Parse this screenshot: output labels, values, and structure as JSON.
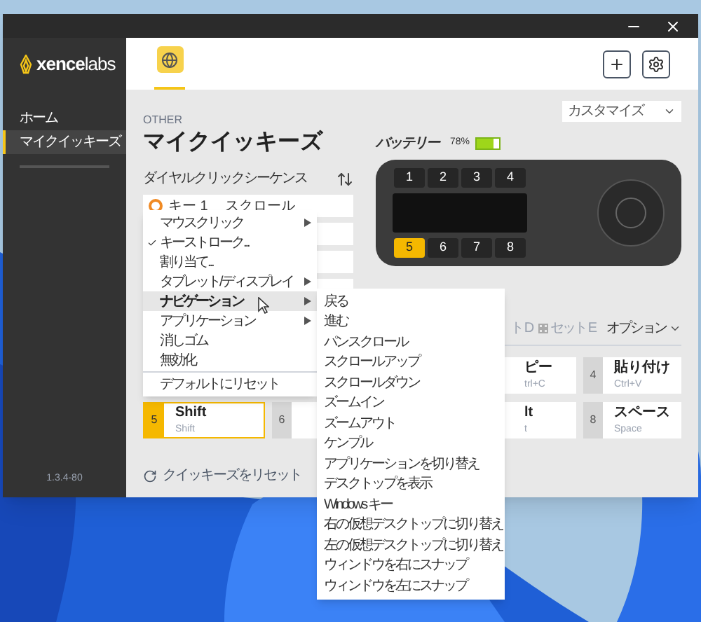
{
  "sidebar": {
    "logo": "**xence**labs",
    "items": [
      {
        "label": "ホーム",
        "selected": false
      },
      {
        "label": "マイクイッキーズ",
        "selected": true
      }
    ],
    "version": "1.3.4-80"
  },
  "app_tabs": [
    {
      "selected": true
    }
  ],
  "header": {
    "section": "OTHER",
    "title": "マイクイッキーズ"
  },
  "dial": {
    "label": "ダイヤルクリックシーケンス",
    "rows": [
      {
        "key": "キー 1",
        "action": "スクロール"
      }
    ]
  },
  "profile_select": {
    "value": "カスタマイズ"
  },
  "battery": {
    "label": "バッテリー",
    "reading": "78%",
    "level": 0.78
  },
  "device": {
    "top_keys": [
      {
        "label": "1",
        "selected": false
      },
      {
        "label": "2",
        "selected": false
      },
      {
        "label": "3",
        "selected": false
      },
      {
        "label": "4",
        "selected": false
      }
    ],
    "bottom_keys": [
      {
        "label": "5",
        "selected": true
      },
      {
        "label": "6",
        "selected": false
      },
      {
        "label": "7",
        "selected": false
      },
      {
        "label": "8",
        "selected": false
      }
    ]
  },
  "set_tabs": [
    {
      "label": "ト D",
      "icon": false
    },
    {
      "label": "セット E",
      "icon": true
    }
  ],
  "options": {
    "label": "オプション"
  },
  "key_rows": [
    [
      {
        "kind": "partial",
        "title": "ピー",
        "subtitle": "trl+C"
      },
      {
        "kind": "full",
        "number": "4",
        "title": "貼り付け",
        "subtitle": "Ctrl+V",
        "selected": false
      }
    ],
    [
      {
        "kind": "full",
        "number": "5",
        "title": "Shift",
        "subtitle": "Shift",
        "selected": true
      },
      {
        "kind": "number",
        "number": "6",
        "selected": false
      },
      {
        "kind": "partial",
        "title": "lt",
        "subtitle": "t"
      },
      {
        "kind": "full",
        "number": "8",
        "title": "スペース",
        "subtitle": "Space",
        "selected": false
      }
    ]
  ],
  "reset": {
    "label": "クイッキーズをリセット"
  },
  "context_menu": {
    "items": [
      {
        "kind": "submenu",
        "label": "マウスクリック",
        "checked": false,
        "selected": false
      },
      {
        "kind": "plain",
        "label": "キーストローク...",
        "checked": true,
        "selected": false
      },
      {
        "kind": "plain",
        "label": "割り当て...",
        "checked": false,
        "selected": false
      },
      {
        "kind": "submenu",
        "label": "タブレット/ディスプレイ",
        "checked": false,
        "selected": false
      },
      {
        "kind": "submenu",
        "label": "ナビゲーション",
        "checked": false,
        "selected": true
      },
      {
        "kind": "submenu",
        "label": "アプリケーション",
        "checked": false,
        "selected": false
      },
      {
        "kind": "plain",
        "label": "消しゴム",
        "checked": false,
        "selected": false
      },
      {
        "kind": "plain",
        "label": "無効化",
        "checked": false,
        "selected": false
      },
      {
        "kind": "separator"
      },
      {
        "kind": "plain",
        "label": "デフォルトにリセット",
        "checked": false,
        "selected": false
      }
    ]
  },
  "submenu": {
    "items": [
      "戻る",
      "進む",
      "パンスクロール",
      "スクロールアップ",
      "スクロールダウン",
      "ズームイン",
      "ズームアウト",
      "ケンプル",
      "アプリケーションを切り替え",
      "デスクトップを表示",
      "Windows キー",
      "右の仮想デスクトップに切り替え",
      "左の仮想デスクトップに切り替え",
      "ウィンドウを右にスナップ",
      "ウィンドウを左にスナップ"
    ]
  }
}
